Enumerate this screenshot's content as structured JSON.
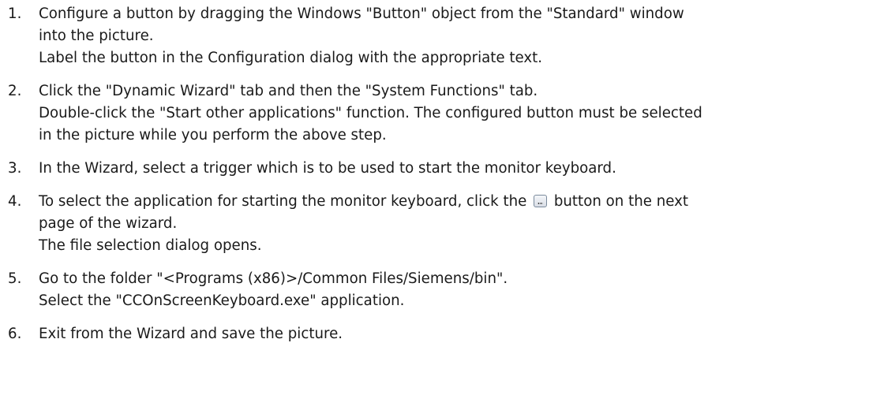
{
  "steps": [
    {
      "number": "1.",
      "lines": [
        "Configure a button by dragging the Windows \"Button\" object from the \"Standard\" window",
        "into the picture.",
        "Label the button in the Configuration dialog with the appropriate text."
      ]
    },
    {
      "number": "2.",
      "lines": [
        "Click the \"Dynamic Wizard\" tab and then the \"System Functions\" tab.",
        "Double-click the \"Start other applications\" function. The configured button must be selected",
        "in the picture while you perform the above step."
      ]
    },
    {
      "number": "3.",
      "lines": [
        "In the Wizard, select a trigger which is to be used to start the monitor keyboard."
      ]
    },
    {
      "number": "4.",
      "line1_before": "To select the application for starting the monitor keyboard, click the",
      "line1_after": "button on the next",
      "inline_icon": "browse-ellipsis-button-icon",
      "lines_after": [
        "page of the wizard.",
        "The file selection dialog opens."
      ]
    },
    {
      "number": "5.",
      "lines": [
        "Go to the folder \"<Programs (x86)>/Common Files/Siemens/bin\".",
        "Select the \"CCOnScreenKeyboard.exe\" application."
      ]
    },
    {
      "number": "6.",
      "lines": [
        "Exit from the Wizard and save the picture."
      ]
    }
  ]
}
